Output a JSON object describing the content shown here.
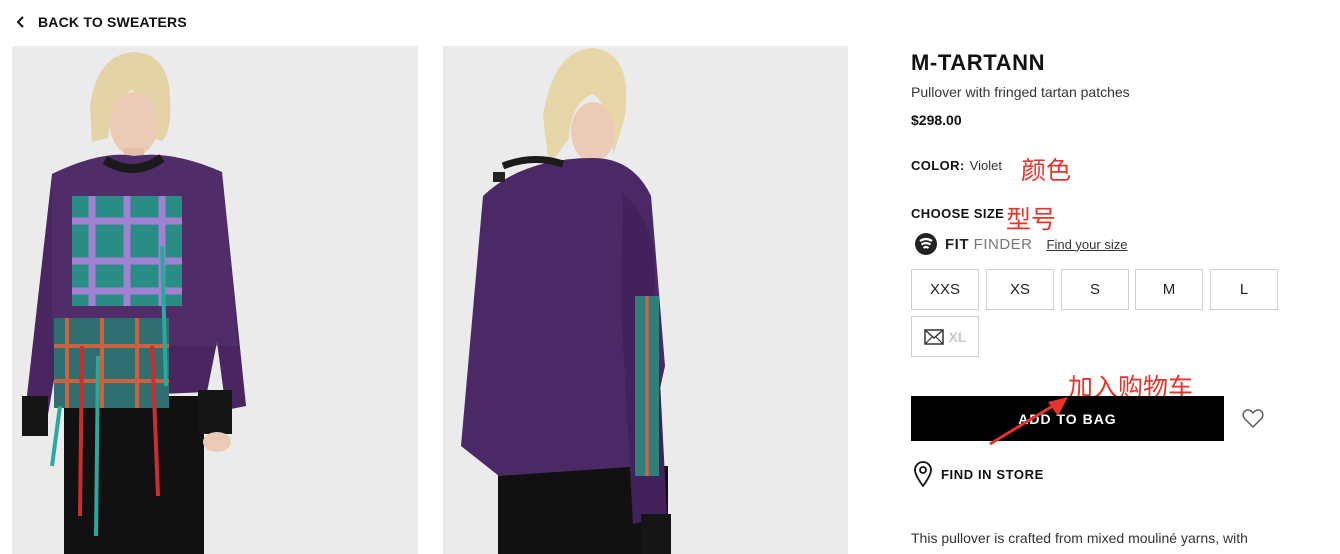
{
  "nav": {
    "back_label": "BACK TO SWEATERS"
  },
  "product": {
    "title": "M-TARTANN",
    "subtitle": "Pullover with fringed tartan patches",
    "price": "$298.00",
    "color_label": "COLOR:",
    "color_value": "Violet",
    "choose_size_label": "CHOOSE SIZE",
    "fit_finder": {
      "brand_bold": "FIT",
      "brand_light": "FINDER",
      "link": "Find your size"
    },
    "sizes": [
      "XXS",
      "XS",
      "S",
      "M",
      "L"
    ],
    "unavailable_size": "XL",
    "add_to_bag": "ADD TO BAG",
    "find_in_store": "FIND IN STORE",
    "description": "This pullover is crafted from mixed mouliné yarns, with"
  },
  "annotations": {
    "color": "颜色",
    "size": "型号",
    "add_to_bag": "加入购物车"
  },
  "icons": {
    "back": "chevron-left-icon",
    "fitfinder": "fitfinder-logo-icon",
    "mail": "mail-icon",
    "heart": "heart-icon",
    "pin": "map-pin-icon"
  },
  "colors": {
    "annotation_red": "#e8332a",
    "button_black": "#000000",
    "image_bg": "#ebebeb"
  }
}
